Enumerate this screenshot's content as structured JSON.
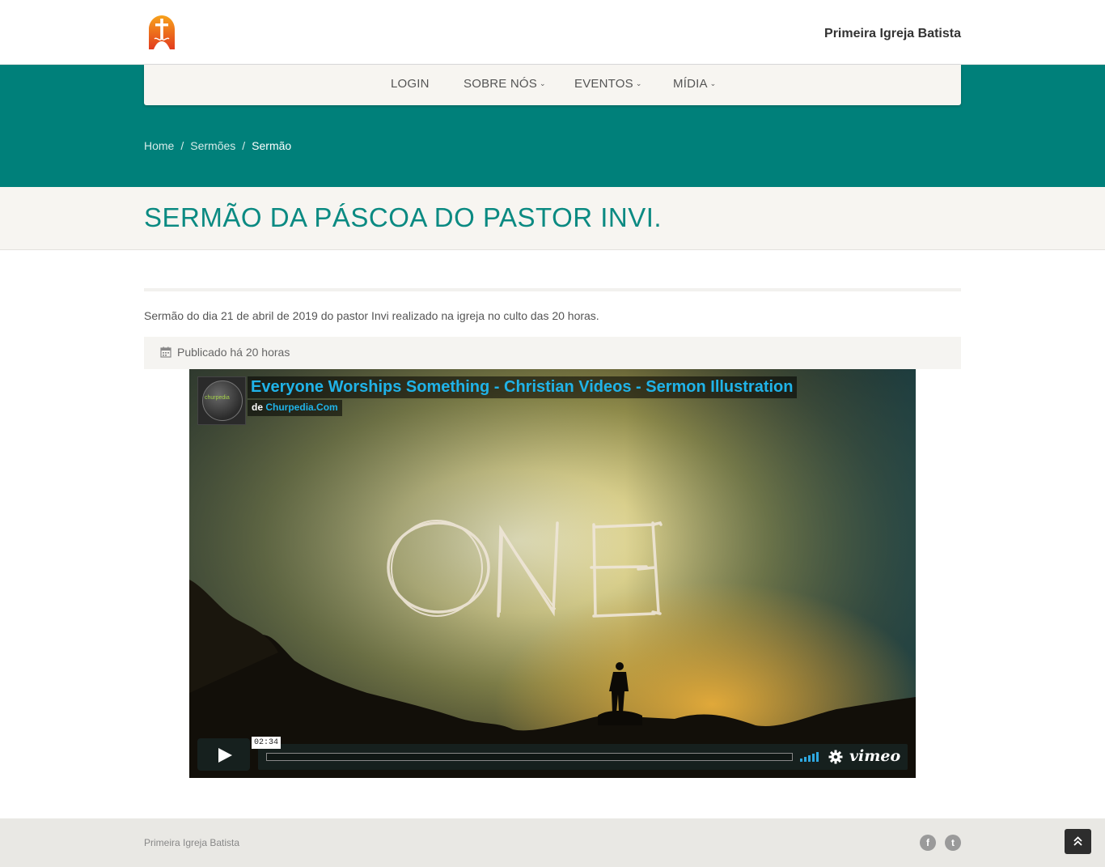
{
  "header": {
    "site_name": "Primeira Igreja Batista",
    "logo_icon": "church-cross-icon"
  },
  "nav": {
    "items": [
      {
        "label": "LOGIN",
        "dropdown": false
      },
      {
        "label": "SOBRE NÓS",
        "dropdown": true
      },
      {
        "label": "EVENTOS",
        "dropdown": true
      },
      {
        "label": "MÍDIA",
        "dropdown": true
      }
    ],
    "caret": "⌄"
  },
  "breadcrumb": {
    "items": [
      "Home",
      "Sermões",
      "Sermão"
    ],
    "separator": "/"
  },
  "page": {
    "title": "SERMÃO DA PÁSCOA DO PASTOR INVI.",
    "description": "Sermão do dia 21 de abril de 2019 do pastor Invi realizado na igreja no culto das 20 horas.",
    "published": "Publicado há 20 horas",
    "published_icon": "calendar-icon"
  },
  "video": {
    "title": "Everyone Worships Something - Christian Videos - Sermon Illustration",
    "by_prefix": "de",
    "channel": "Churpedia.Com",
    "portrait_brand": "churpedia",
    "scene_text": "ONE",
    "timecode": "02:34",
    "provider": "vimeo",
    "progress": 0
  },
  "footer": {
    "text": "Primeira Igreja Batista",
    "social": [
      {
        "name": "facebook-icon",
        "glyph": "f"
      },
      {
        "name": "twitter-icon",
        "glyph": "t"
      }
    ],
    "back_to_top_icon": "double-chevron-up-icon"
  },
  "colors": {
    "teal": "#00807a",
    "title_teal": "#0b8a82",
    "link_blue": "#20b3e8"
  }
}
